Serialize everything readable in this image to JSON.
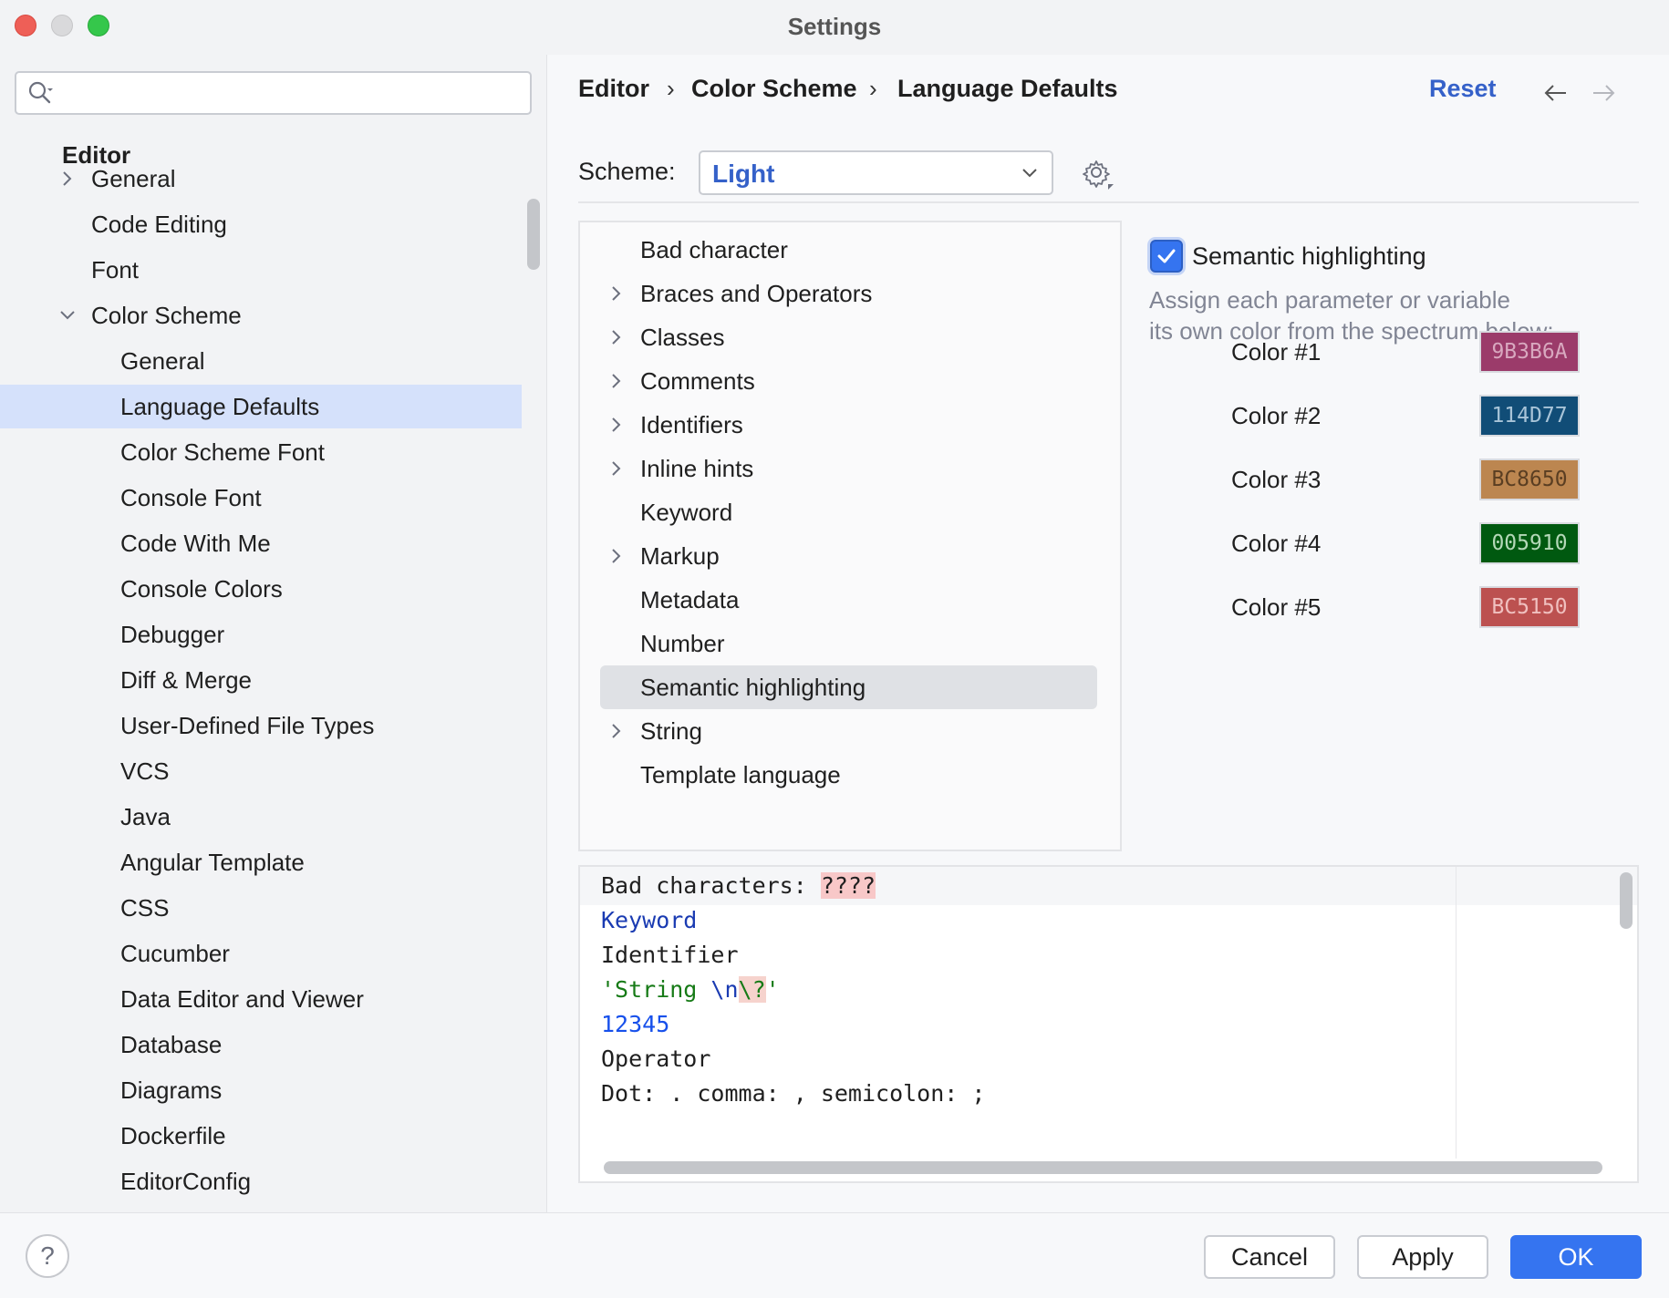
{
  "window": {
    "title": "Settings"
  },
  "search": {
    "placeholder": "",
    "value": ""
  },
  "sidebar": {
    "section": "Editor",
    "items": [
      {
        "label": "General",
        "chevron": "right"
      },
      {
        "label": "Code Editing"
      },
      {
        "label": "Font"
      },
      {
        "label": "Color Scheme",
        "chevron": "down"
      },
      {
        "label": "General"
      },
      {
        "label": "Language Defaults",
        "selected": true
      },
      {
        "label": "Color Scheme Font"
      },
      {
        "label": "Console Font"
      },
      {
        "label": "Code With Me"
      },
      {
        "label": "Console Colors"
      },
      {
        "label": "Debugger"
      },
      {
        "label": "Diff & Merge"
      },
      {
        "label": "User-Defined File Types"
      },
      {
        "label": "VCS"
      },
      {
        "label": "Java"
      },
      {
        "label": "Angular Template"
      },
      {
        "label": "CSS"
      },
      {
        "label": "Cucumber"
      },
      {
        "label": "Data Editor and Viewer"
      },
      {
        "label": "Database"
      },
      {
        "label": "Diagrams"
      },
      {
        "label": "Dockerfile"
      },
      {
        "label": "EditorConfig"
      }
    ]
  },
  "breadcrumb": {
    "items": [
      "Editor",
      "Color Scheme",
      "Language Defaults"
    ],
    "separator": "›"
  },
  "header": {
    "reset_label": "Reset"
  },
  "scheme": {
    "label": "Scheme:",
    "value": "Light"
  },
  "categories": [
    {
      "label": "Bad character"
    },
    {
      "label": "Braces and Operators",
      "expandable": true
    },
    {
      "label": "Classes",
      "expandable": true
    },
    {
      "label": "Comments",
      "expandable": true
    },
    {
      "label": "Identifiers",
      "expandable": true
    },
    {
      "label": "Inline hints",
      "expandable": true
    },
    {
      "label": "Keyword"
    },
    {
      "label": "Markup",
      "expandable": true
    },
    {
      "label": "Metadata"
    },
    {
      "label": "Number"
    },
    {
      "label": "Semantic highlighting",
      "selected": true
    },
    {
      "label": "String",
      "expandable": true
    },
    {
      "label": "Template language"
    }
  ],
  "options": {
    "semantic_label": "Semantic highlighting",
    "semantic_checked": true,
    "hint_line1": "Assign each parameter or variable",
    "hint_line2": "its own color from the spectrum below:",
    "colors": [
      {
        "label": "Color #1",
        "hex": "9B3B6A",
        "color": "#9B3B6A",
        "text_color": "#d8a8bf"
      },
      {
        "label": "Color #2",
        "hex": "114D77",
        "color": "#114D77",
        "text_color": "#a8c4d8"
      },
      {
        "label": "Color #3",
        "hex": "BC8650",
        "color": "#BC8650",
        "text_color": "#5a3e22"
      },
      {
        "label": "Color #4",
        "hex": "005910",
        "color": "#005910",
        "text_color": "#b4d8b8"
      },
      {
        "label": "Color #5",
        "hex": "BC5150",
        "color": "#BC5150",
        "text_color": "#f0c0bf"
      }
    ]
  },
  "preview": {
    "line1_text": "Bad characters: ",
    "line1_bad": "????",
    "keyword": "Keyword",
    "identifier": "Identifier",
    "string_start": "'String ",
    "string_escape": "\\n",
    "string_bad_escape": "\\?",
    "string_end": "'",
    "number": "12345",
    "operator": "Operator",
    "dots_line": "Dot: . comma: , semicolon: ;"
  },
  "footer": {
    "help_label": "?",
    "cancel_label": "Cancel",
    "apply_label": "Apply",
    "ok_label": "OK"
  },
  "colors": {
    "accent": "#3574f0",
    "link": "#3561c9",
    "selection": "#d5e1fb"
  }
}
